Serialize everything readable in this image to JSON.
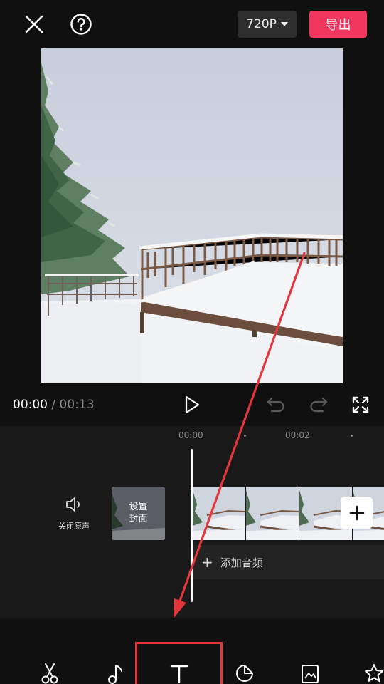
{
  "header": {
    "resolution_label": "720P",
    "export_label": "导出",
    "close_icon": "close-icon",
    "help_icon": "help-icon"
  },
  "player": {
    "current_time": "00:00",
    "separator": "/",
    "total_time": "00:13",
    "play_icon": "play-icon",
    "undo_icon": "undo-icon",
    "redo_icon": "redo-icon",
    "fullscreen_icon": "fullscreen-icon"
  },
  "timeline": {
    "ruler": [
      "00:00",
      "00:02"
    ],
    "mute_label": "关闭原声",
    "cover_label_line1": "设置",
    "cover_label_line2": "封面",
    "add_audio_label": "添加音频"
  },
  "toolbar": {
    "tools": [
      "scissors-icon",
      "music-icon",
      "text-icon",
      "sticker-icon",
      "image-icon",
      "effects-icon"
    ],
    "highlighted_tool": "text-icon"
  },
  "colors": {
    "export": "#f0365d",
    "annotation": "#e2363c",
    "background": "#101010"
  }
}
